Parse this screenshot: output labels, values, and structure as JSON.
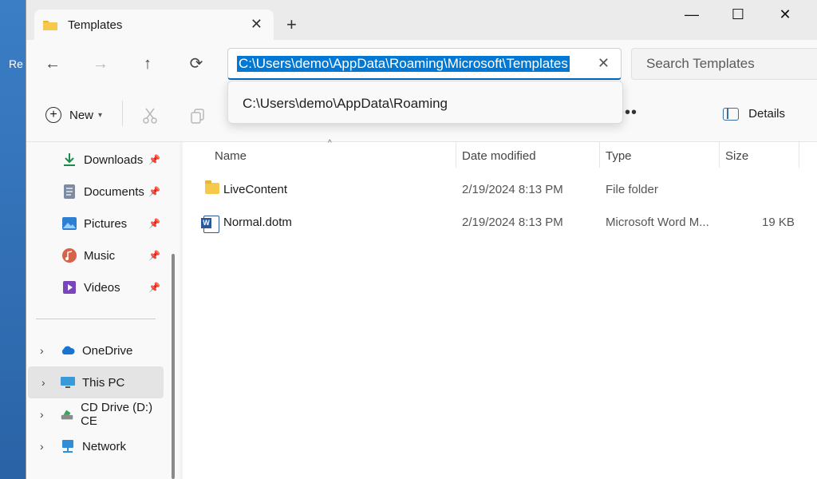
{
  "desktop": {
    "label": "Re"
  },
  "window": {
    "tab_title": "Templates",
    "tab_close": "✕",
    "new_tab": "+",
    "minimize": "—",
    "maximize": "☐",
    "close": "✕"
  },
  "nav": {
    "back": "←",
    "forward": "→",
    "up": "↑",
    "refresh": "⟳",
    "address_value": "C:\\Users\\demo\\AppData\\Roaming\\Microsoft\\Templates",
    "address_clear": "✕",
    "search_placeholder": "Search Templates",
    "suggestion": "C:\\Users\\demo\\AppData\\Roaming"
  },
  "commands": {
    "new_label": "New",
    "cut_icon": "scissors-icon",
    "copy_icon": "copy-icon",
    "more": "•••",
    "details_label": "Details"
  },
  "sidebar": {
    "pinned": [
      {
        "label": "Downloads",
        "icon": "download-icon",
        "color": "#1e8a4a"
      },
      {
        "label": "Documents",
        "icon": "document-icon",
        "color": "#5b6b84"
      },
      {
        "label": "Pictures",
        "icon": "pictures-icon",
        "color": "#2d7fd3"
      },
      {
        "label": "Music",
        "icon": "music-icon",
        "color": "#d8614a"
      },
      {
        "label": "Videos",
        "icon": "videos-icon",
        "color": "#7a45b8"
      }
    ],
    "tree": [
      {
        "label": "OneDrive",
        "icon": "cloud-icon",
        "color": "#1a73d1"
      },
      {
        "label": "This PC",
        "icon": "monitor-icon",
        "color": "#3a9ad9",
        "selected": true
      },
      {
        "label": "CD Drive (D:) CE",
        "icon": "cd-drive-icon",
        "color": "#3aa35a"
      },
      {
        "label": "Network",
        "icon": "network-icon",
        "color": "#2f8ed6"
      }
    ]
  },
  "columns": {
    "name": "Name",
    "date": "Date modified",
    "type": "Type",
    "size": "Size"
  },
  "files": [
    {
      "name": "LiveContent",
      "date": "2/19/2024 8:13 PM",
      "type": "File folder",
      "size": ""
    },
    {
      "name": "Normal.dotm",
      "date": "2/19/2024 8:13 PM",
      "type": "Microsoft Word M...",
      "size": "19 KB"
    }
  ]
}
